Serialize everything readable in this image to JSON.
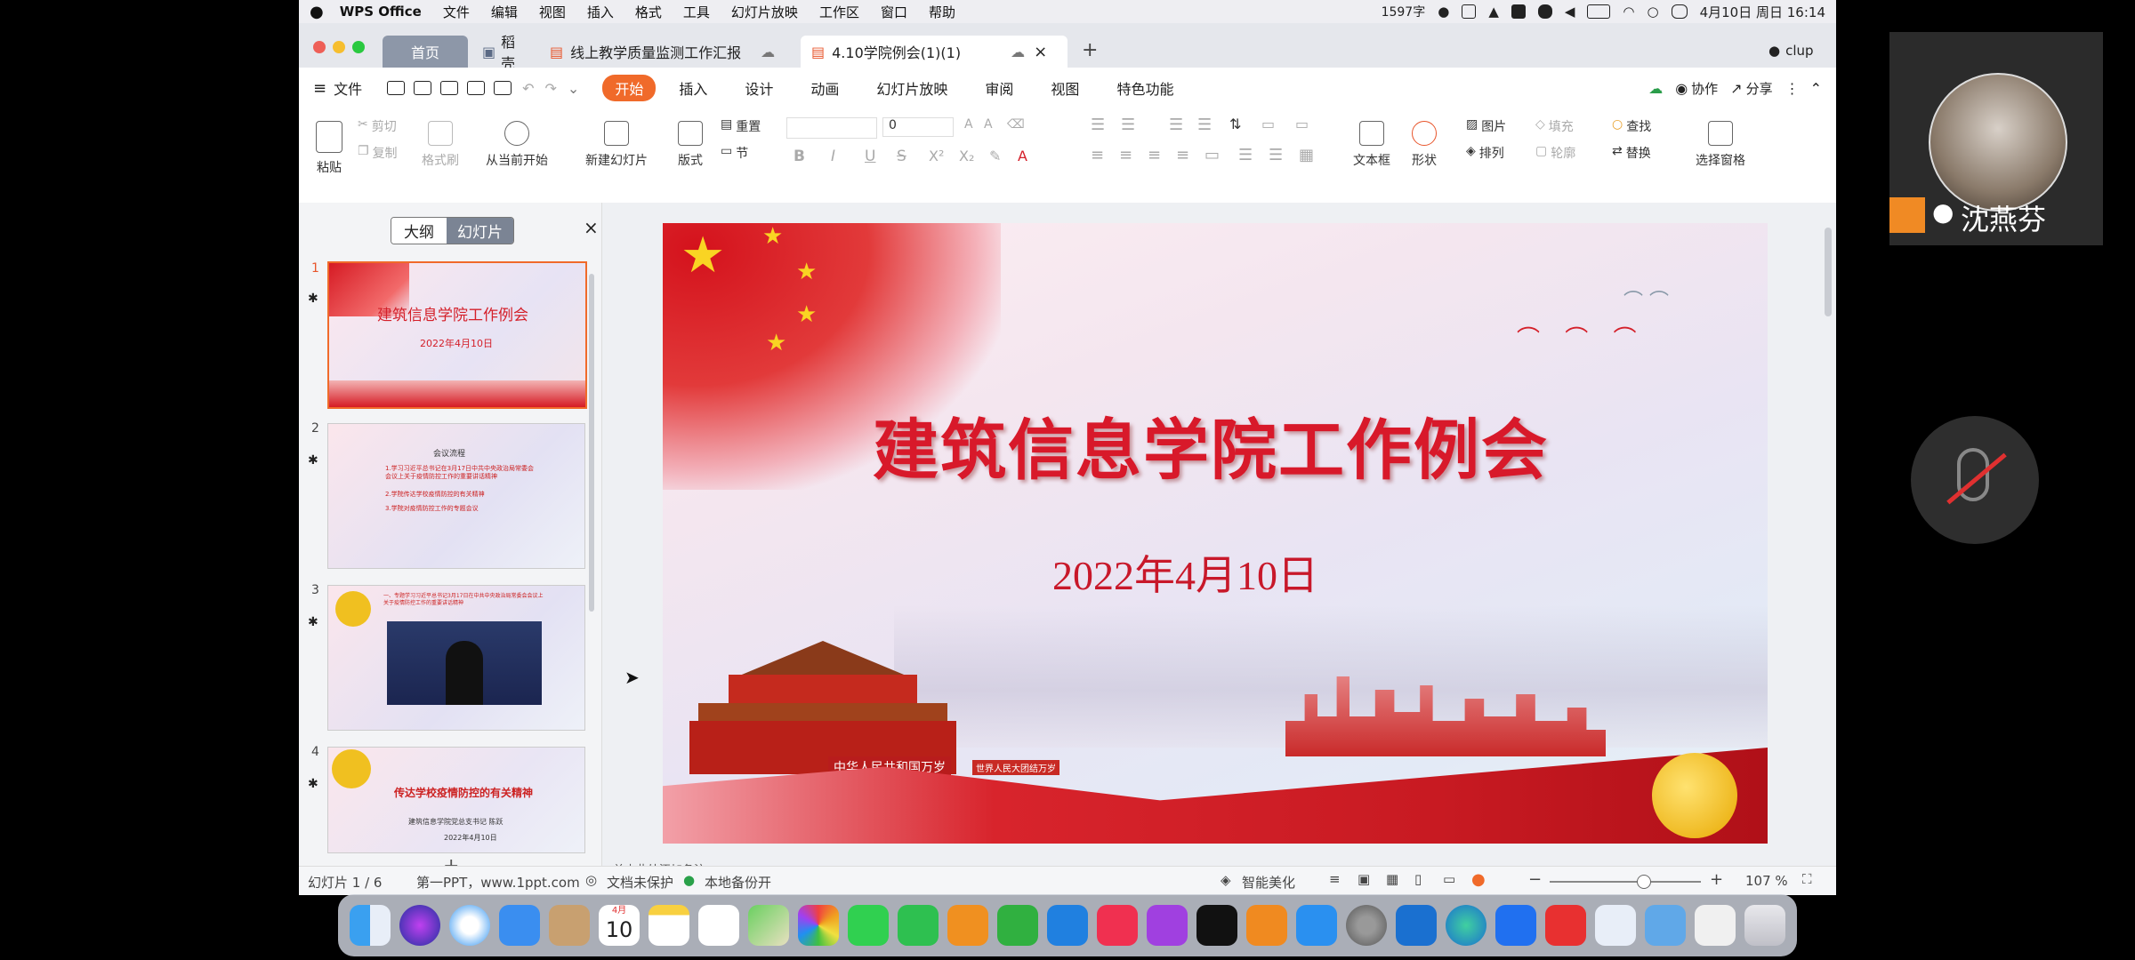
{
  "menubar": {
    "app_name": "WPS Office",
    "items": [
      "文件",
      "编辑",
      "视图",
      "插入",
      "格式",
      "工具",
      "幻灯片放映",
      "工作区",
      "窗口",
      "帮助"
    ],
    "word_count": "1597字",
    "datetime": "4月10日 周日  16:14"
  },
  "window": {
    "tabs": [
      {
        "label": "首页"
      },
      {
        "label": "稻壳"
      },
      {
        "label": "线上教学质量监测工作汇报"
      },
      {
        "label": "4.10学院例会(1)(1)"
      }
    ],
    "add_tab": "+",
    "user": "clup"
  },
  "toolbar": {
    "file_label": "文件",
    "menu_tabs": [
      "开始",
      "插入",
      "设计",
      "动画",
      "幻灯片放映",
      "审阅",
      "视图",
      "特色功能"
    ],
    "collab": "协作",
    "share": "分享"
  },
  "ribbon": {
    "paste": "粘贴",
    "cut": "剪切",
    "copy": "复制",
    "format_painter": "格式刷",
    "play_from_current": "从当前开始",
    "new_slide": "新建幻灯片",
    "layout": "版式",
    "reset": "重置",
    "section": "节",
    "font_size": "0",
    "textbox": "文本框",
    "shape": "形状",
    "picture": "图片",
    "fill": "填充",
    "arrange": "排列",
    "outline": "轮廓",
    "find": "查找",
    "replace": "替换",
    "selection_pane": "选择窗格"
  },
  "left_pane": {
    "view_tabs": [
      "大纲",
      "幻灯片"
    ],
    "close": "×",
    "add": "+",
    "slides": [
      {
        "num": "1",
        "title": "建筑信息学院工作例会",
        "subtitle": "2022年4月10日"
      },
      {
        "num": "2",
        "title": "会议流程",
        "lines": [
          "1.学习习近平总书记在3月17日中共中央政治局常委会会议上关于疫情防控工作的重要讲话精神",
          "2.学院传达学校疫情防控的有关精神",
          "3.学院对疫情防控工作的专题会议"
        ]
      },
      {
        "num": "3",
        "title": "一、专题学习习近平总书记3月17日在中共中央政治局常委会会议上关于疫情防控工作的重要讲话精神"
      },
      {
        "num": "4",
        "title": "传达学校疫情防控的有关精神",
        "subtitle": "建筑信息学院党总支书记  陈跃",
        "date": "2022年4月10日"
      }
    ]
  },
  "slide": {
    "title": "建筑信息学院工作例会",
    "date": "2022年4月10日",
    "plaque": "中华人民共和国万岁",
    "plaque2": "世界人民大团结万岁"
  },
  "notes_placeholder": "单击此处添加备注",
  "statusbar": {
    "slide_count": "幻灯片 1 / 6",
    "theme": "第一PPT，www.1ppt.com",
    "protect": "文档未保护",
    "backup": "本地备份开",
    "beautify": "智能美化",
    "zoom_minus": "−",
    "zoom_plus": "+",
    "zoom_value": "107 %",
    "zoom_level": 0.62
  },
  "video": {
    "name": "沈燕芬"
  },
  "dock": {
    "calendar_month": "4月",
    "calendar_day": "10"
  },
  "colors": {
    "accent_orange": "#f06a2a",
    "slide_red": "#d4202a",
    "window_bg": "#f5f6f8"
  }
}
